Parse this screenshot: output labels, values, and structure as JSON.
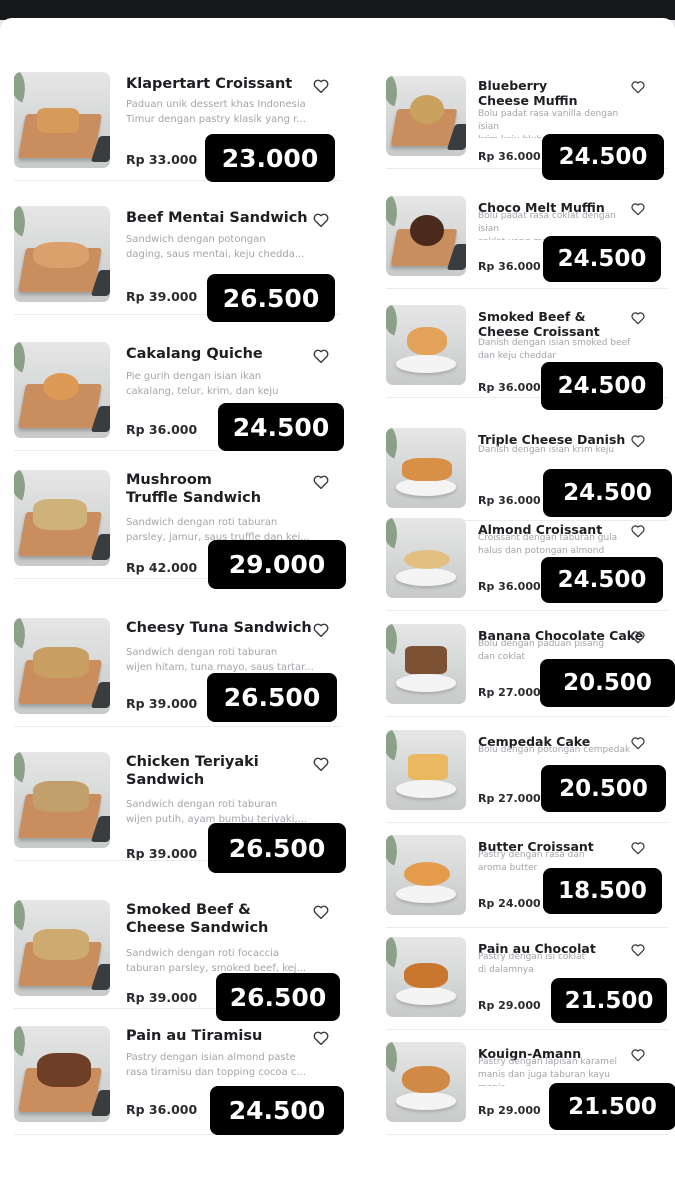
{
  "menu": {
    "left": [
      {
        "name": "Klapertart Croissant",
        "description": "Paduan unik dessert khas Indonesia\nTimur dengan pastry klasik yang r...",
        "price": "Rp 33.000",
        "promo_price": "23.000"
      },
      {
        "name": "Beef  Mentai Sandwich",
        "description": "Sandwich dengan potongan\ndaging, saus mentai, keju chedda...",
        "price": "Rp 39.000",
        "promo_price": "26.500"
      },
      {
        "name": "Cakalang Quiche",
        "description": "Pie gurih dengan isian ikan\ncakalang, telur, krim, dan keju",
        "price": "Rp 36.000",
        "promo_price": "24.500"
      },
      {
        "name": "Mushroom\nTruffle Sandwich",
        "description": "Sandwich dengan roti taburan\nparsley, jamur, saus truffle dan kej...",
        "price": "Rp 42.000",
        "promo_price": "29.000"
      },
      {
        "name": "Cheesy Tuna Sandwich",
        "description": "Sandwich dengan roti taburan\nwijen hitam, tuna mayo, saus tartar...",
        "price": "Rp 39.000",
        "promo_price": "26.500"
      },
      {
        "name": "Chicken Teriyaki\nSandwich",
        "description": "Sandwich dengan roti taburan\nwijen putih, ayam bumbu teriyaki,...",
        "price": "Rp 39.000",
        "promo_price": "26.500"
      },
      {
        "name": "Smoked Beef &\nCheese Sandwich",
        "description": "Sandwich dengan roti focaccia\ntaburan parsley, smoked beef, kej...",
        "price": "Rp 39.000",
        "promo_price": "26.500"
      },
      {
        "name": "Pain au Tiramisu",
        "description": "Pastry dengan isian almond paste\nrasa tiramisu dan topping cocoa c...",
        "price": "Rp 36.000",
        "promo_price": "24.500"
      }
    ],
    "right": [
      {
        "name": "Blueberry\nCheese Muffin",
        "description": "Bolu padat rasa vanilla dengan isian\nkrim keju bluberi dan topping cru...",
        "price": "Rp 36.000",
        "promo_price": "24.500"
      },
      {
        "name": "Choco Melt Muffin",
        "description": "Bolu padat rasa coklat dengan isian\ncoklat yang meleleh dan topping...",
        "price": "Rp 36.000",
        "promo_price": "24.500"
      },
      {
        "name": "Smoked Beef &\nCheese Croissant",
        "description": "Danish dengan isian smoked beef\ndan keju cheddar",
        "price": "Rp 36.000",
        "promo_price": "24.500"
      },
      {
        "name": "Triple Cheese Danish",
        "description": "Danish dengan isian krim keju",
        "price": "Rp 36.000",
        "promo_price": "24.500"
      },
      {
        "name": "Almond Croissant",
        "description": "Croissant dengan taburan gula\nhalus dan potongan almond",
        "price": "Rp 36.000",
        "promo_price": "24.500"
      },
      {
        "name": "Banana Chocolate Cake",
        "description": "Bolu dengan paduan pisang\ndan coklat",
        "price": "Rp 27.000",
        "promo_price": "20.500"
      },
      {
        "name": "Cempedak Cake",
        "description": "Bolu dengan potongan cempedak",
        "price": "Rp 27.000",
        "promo_price": "20.500"
      },
      {
        "name": "Butter Croissant",
        "description": "Pastry dengan rasa dan\naroma butter",
        "price": "Rp 24.000",
        "promo_price": "18.500"
      },
      {
        "name": "Pain au Chocolat",
        "description": "Pastry dengan isi coklat\ndi dalamnya",
        "price": "Rp 29.000",
        "promo_price": "21.500"
      },
      {
        "name": "Kouign-Amann",
        "description": "Pastry dengan lapisan karamel\nmanis dan juga taburan kayu manis",
        "price": "Rp 29.000",
        "promo_price": "21.500"
      }
    ]
  },
  "icons": {
    "favorite": "heart-outline-icon"
  },
  "colors": {
    "badge_bg": "#000000",
    "badge_text": "#ffffff",
    "title": "#1e1f22",
    "description": "#a2a5aa",
    "price": "#2a2b2e"
  }
}
